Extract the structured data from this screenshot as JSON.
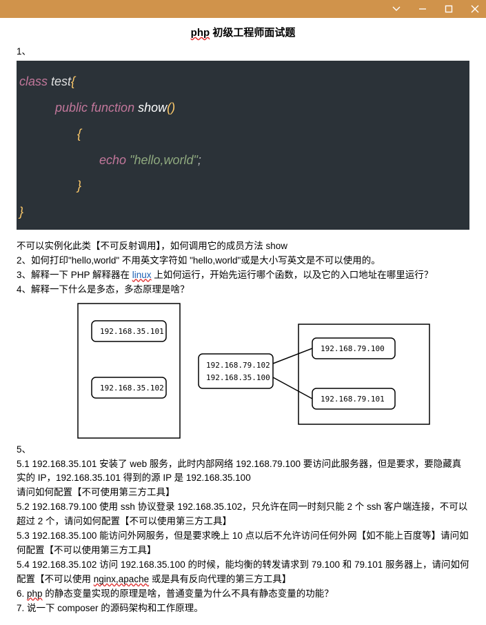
{
  "window": {
    "chevron_title": "chevron-down",
    "minimize_title": "minimize",
    "maximize_title": "maximize",
    "close_title": "close"
  },
  "title": {
    "prefix": "php",
    "rest": " 初级工程师面试题"
  },
  "q1": {
    "label": "1、",
    "code": {
      "kw_class": "class",
      "cname": " test",
      "brace_open": "{",
      "kw_public": "public",
      "kw_function": " function",
      "fname": " show",
      "paren_open": "(",
      "paren_close": ")",
      "brace_in_open": "{",
      "echo": "echo",
      "str": " \"hello,world\"",
      "semi": ";",
      "brace_in_close": "}",
      "brace_close": "}"
    },
    "after": "不可以实例化此类【不可反射调用】，如何调用它的成员方法 show"
  },
  "q2": "2、如何打印\"hello,world\" 不用英文字符如 \"hello,world\"或是大小写英文是不可以使用的。",
  "q3": {
    "pre": "3、解释一下 PHP 解释器在 ",
    "linux": "linux",
    "post": " 上如何运行，开始先运行哪个函数，以及它的入口地址在哪里运行？"
  },
  "q4": "4、解释一下什么是多态，多态原理是啥？",
  "ips": {
    "left_top": "192.168.35.101",
    "left_bottom": "192.168.35.102",
    "mid_top": "192.168.79.102",
    "mid_bottom": "192.168.35.100",
    "right_top": "192.168.79.100",
    "right_bottom": "192.168.79.101"
  },
  "q5label": "5、",
  "q5_1": "5.1 192.168.35.101 安装了 web 服务，此时内部网络 192.168.79.100 要访问此服务器，但是要求，要隐藏真实的 IP，192.168.35.101 得到的源 IP 是 192.168.35.100",
  "q5_1b": "请问如何配置【不可使用第三方工具】",
  "q5_2": "5.2 192.168.79.100 使用 ssh 协议登录 192.168.35.102，只允许在同一时刻只能 2 个 ssh 客户端连接，不可以超过 2 个，请问如何配置【不可以使用第三方工具】",
  "q5_3": "5.3 192.168.35.100 能访问外网服务，但是要求晚上 10 点以后不允许访问任何外网【如不能上百度等】请问如何配置【不可以使用第三方工具】",
  "q5_4": {
    "pre": "5.4 192.168.35.102 访问 192.168.35.100 的时候，能均衡的转发请求到 79.100 和 79.101 服务器上，请问如何配置【不可以使用 ",
    "wave": "nginx,apache",
    "post": " 或是具有反向代理的第三方工具】"
  },
  "q6": {
    "pre": "6. ",
    "wave": "php",
    "post": " 的静态变量实现的原理是啥，普通变量为什么不具有静态变量的功能？"
  },
  "q7": "7. 说一下 composer 的源码架构和工作原理。"
}
